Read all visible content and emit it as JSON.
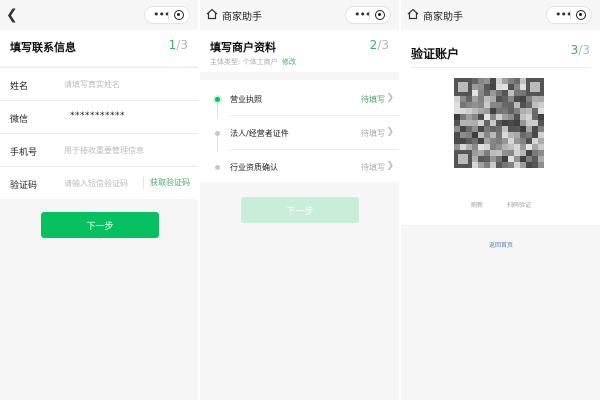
{
  "screen1": {
    "title": "填写联系信息",
    "step_current": "1",
    "step_total": "/3",
    "fields": [
      {
        "label": "姓名",
        "placeholder": "请填写真实姓名"
      },
      {
        "label": "微信",
        "value": "***********"
      },
      {
        "label": "手机号",
        "placeholder": "用于接收重要管理信息"
      },
      {
        "label": "验证码",
        "placeholder": "请输入短信验证码",
        "action": "获取验证码"
      }
    ],
    "next_label": "下一步"
  },
  "screen2": {
    "nav_title": "商家助手",
    "title": "填写商户资料",
    "step_current": "2",
    "step_total": "/3",
    "subject_label": "主体类型:",
    "subject_value": "个体工商户",
    "edit_label": "修改",
    "items": [
      {
        "name": "营业执照",
        "status": "待填写"
      },
      {
        "name": "法人/经营者证件",
        "status": "待填写"
      },
      {
        "name": "行业资质确认",
        "status": "待填写"
      }
    ],
    "next_label": "下一步"
  },
  "screen3": {
    "nav_title": "商家助手",
    "title": "验证账户",
    "step_current": "3",
    "step_total": "/3",
    "actions": [
      "刷新",
      "扫码验证"
    ],
    "back_label": "返回首页"
  },
  "colors": {
    "accent": "#07c160",
    "accent_text": "#4aa86a",
    "disabled": "#c8edd8"
  }
}
